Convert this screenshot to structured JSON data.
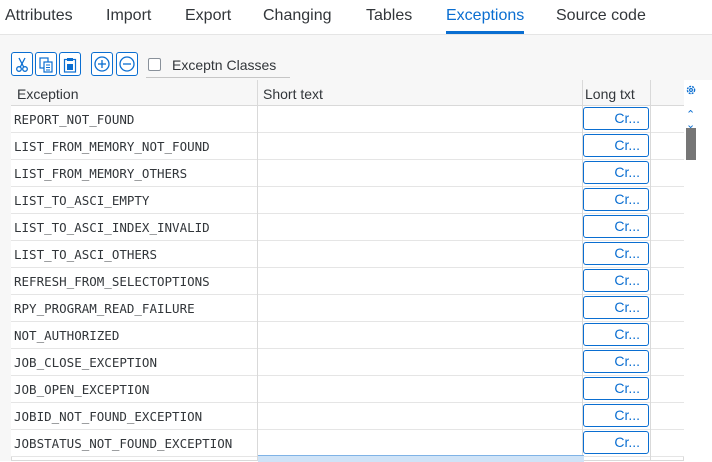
{
  "tabs": [
    {
      "label": "Attributes"
    },
    {
      "label": "Import"
    },
    {
      "label": "Export"
    },
    {
      "label": "Changing"
    },
    {
      "label": "Tables"
    },
    {
      "label": "Exceptions",
      "active": true
    },
    {
      "label": "Source code"
    }
  ],
  "toolbar": {
    "cut_icon": "scissors-icon",
    "copy_icon": "copy-icon",
    "paste_icon": "paste-icon",
    "insert_icon": "plus-circle-icon",
    "delete_icon": "minus-circle-icon",
    "checkbox_label": "Exceptn Classes",
    "checkbox_checked": false
  },
  "table": {
    "columns": [
      "Exception",
      "Short text",
      "Long txt"
    ],
    "settings_icon": "gear-icon",
    "rows": [
      {
        "exception": "REPORT_NOT_FOUND",
        "short_text": "",
        "long_txt": "Cr..."
      },
      {
        "exception": "LIST_FROM_MEMORY_NOT_FOUND",
        "short_text": "",
        "long_txt": "Cr..."
      },
      {
        "exception": "LIST_FROM_MEMORY_OTHERS",
        "short_text": "",
        "long_txt": "Cr..."
      },
      {
        "exception": "LIST_TO_ASCI_EMPTY",
        "short_text": "",
        "long_txt": "Cr..."
      },
      {
        "exception": "LIST_TO_ASCI_INDEX_INVALID",
        "short_text": "",
        "long_txt": "Cr..."
      },
      {
        "exception": "LIST_TO_ASCI_OTHERS",
        "short_text": "",
        "long_txt": "Cr..."
      },
      {
        "exception": "REFRESH_FROM_SELECTOPTIONS",
        "short_text": "",
        "long_txt": "Cr..."
      },
      {
        "exception": "RPY_PROGRAM_READ_FAILURE",
        "short_text": "",
        "long_txt": "Cr..."
      },
      {
        "exception": "NOT_AUTHORIZED",
        "short_text": "",
        "long_txt": "Cr..."
      },
      {
        "exception": "JOB_CLOSE_EXCEPTION",
        "short_text": "",
        "long_txt": "Cr..."
      },
      {
        "exception": "JOB_OPEN_EXCEPTION",
        "short_text": "",
        "long_txt": "Cr..."
      },
      {
        "exception": "JOBID_NOT_FOUND_EXCEPTION",
        "short_text": "",
        "long_txt": "Cr..."
      },
      {
        "exception": "JOBSTATUS_NOT_FOUND_EXCEPTION",
        "short_text": "",
        "long_txt": "Cr..."
      }
    ]
  },
  "colors": {
    "accent": "#0a6ed1",
    "text": "#32363a",
    "border": "#d9d9d9"
  }
}
